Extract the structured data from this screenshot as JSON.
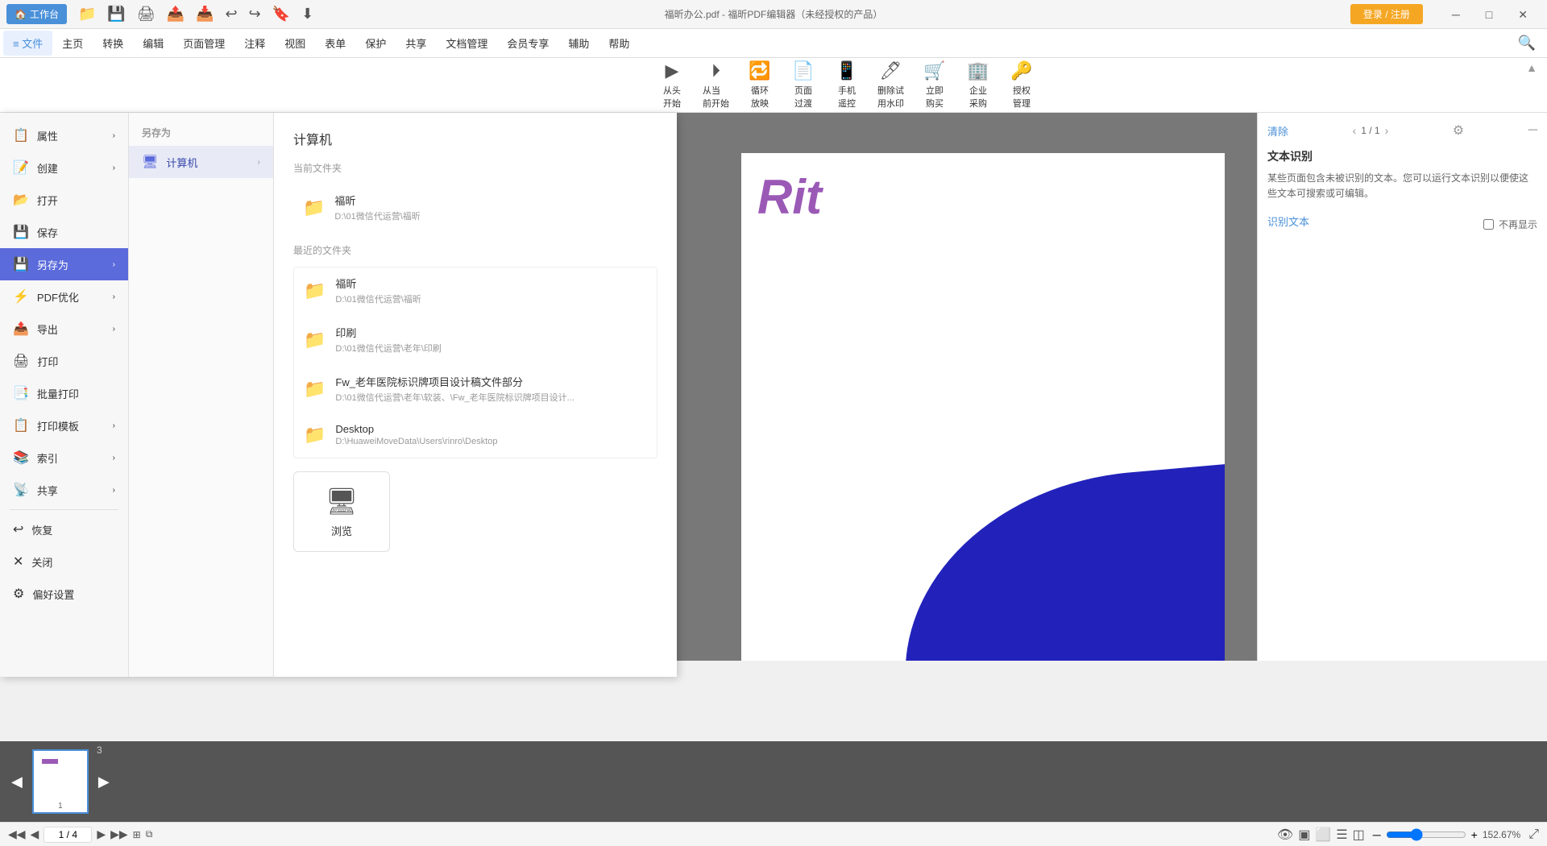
{
  "titlebar": {
    "workbench_label": "工作台",
    "title": "福昕办公.pdf - 福昕PDF编辑器（未经授权的产品）",
    "login_label": "登录 / 注册",
    "toolbar_icons": [
      "folder-open",
      "save",
      "print",
      "export",
      "undo",
      "redo",
      "stamp",
      "download"
    ]
  },
  "menubar": {
    "items": [
      {
        "label": "≡ 文件",
        "key": "file",
        "active": true
      },
      {
        "label": "主页",
        "key": "home"
      },
      {
        "label": "转换",
        "key": "convert"
      },
      {
        "label": "编辑",
        "key": "edit"
      },
      {
        "label": "页面管理",
        "key": "page"
      },
      {
        "label": "注释",
        "key": "annotate"
      },
      {
        "label": "视图",
        "key": "view"
      },
      {
        "label": "表单",
        "key": "form"
      },
      {
        "label": "保护",
        "key": "protect"
      },
      {
        "label": "共享",
        "key": "share"
      },
      {
        "label": "文档管理",
        "key": "doc"
      },
      {
        "label": "会员专享",
        "key": "vip"
      },
      {
        "label": "辅助",
        "key": "assist"
      },
      {
        "label": "帮助",
        "key": "help"
      }
    ]
  },
  "toolbar": {
    "buttons": [
      {
        "label": "从头\n开始",
        "icon": "▶"
      },
      {
        "label": "从当\n前开始",
        "icon": "▶"
      },
      {
        "label": "循环\n放映",
        "icon": "🔄"
      },
      {
        "label": "页面\n过度",
        "icon": "📄"
      },
      {
        "label": "手机\n遥控",
        "icon": "📱"
      },
      {
        "label": "删除试\n用水印",
        "icon": "🖊"
      },
      {
        "label": "立即\n购买",
        "icon": "🛒"
      },
      {
        "label": "企业\n采购",
        "icon": "🏢"
      },
      {
        "label": "授权\n管理",
        "icon": "🔑"
      }
    ]
  },
  "file_menu": {
    "title": "另存为",
    "sidebar_items": [
      {
        "label": "属性",
        "icon": "📋",
        "has_arrow": true
      },
      {
        "label": "创建",
        "icon": "📝",
        "has_arrow": true
      },
      {
        "label": "打开",
        "icon": "📂",
        "has_arrow": false
      },
      {
        "label": "保存",
        "icon": "💾",
        "has_arrow": false
      },
      {
        "label": "另存为",
        "icon": "💾",
        "has_arrow": true,
        "active": true
      },
      {
        "label": "PDF优化",
        "icon": "⚡",
        "has_arrow": true
      },
      {
        "label": "导出",
        "icon": "📤",
        "has_arrow": true
      },
      {
        "label": "打印",
        "icon": "🖨",
        "has_arrow": false
      },
      {
        "label": "批量打印",
        "icon": "📑",
        "has_arrow": false
      },
      {
        "label": "打印模板",
        "icon": "📋",
        "has_arrow": true
      },
      {
        "label": "索引",
        "icon": "📚",
        "has_arrow": true
      },
      {
        "label": "共享",
        "icon": "📡",
        "has_arrow": true
      },
      {
        "label": "恢复",
        "icon": "↩",
        "has_arrow": false
      },
      {
        "label": "关闭",
        "icon": "✕",
        "has_arrow": false
      },
      {
        "label": "偏好设置",
        "icon": "⚙",
        "has_arrow": false
      }
    ],
    "submenu": {
      "title": "另存为",
      "items": [
        {
          "label": "计算机",
          "icon": "🖥",
          "active": true,
          "has_arrow": true
        }
      ]
    },
    "content": {
      "title": "计算机",
      "current_folder_label": "当前文件夹",
      "current_folder": {
        "name": "福昕",
        "path": "D:\\01微信代运营\\福昕"
      },
      "recent_label": "最近的文件夹",
      "recent_folders": [
        {
          "name": "福昕",
          "path": "D:\\01微信代运营\\福昕"
        },
        {
          "name": "印刷",
          "path": "D:\\01微信代运营\\老年\\印刷"
        },
        {
          "name": "Fw_老年医院标识牌项目设计稿文件部分",
          "path": "D:\\01微信代运营\\老年\\软装、\\Fw_老年医院标识牌项目设计..."
        },
        {
          "name": "Desktop",
          "path": "D:\\HuaweiMoveData\\Users\\rinro\\Desktop"
        }
      ],
      "browse_label": "浏览"
    }
  },
  "right_panel": {
    "clear_label": "清除",
    "page_info": "1 / 1",
    "section_title": "文本识别",
    "description": "某些页面包含未被识别的文本。您可以运行文本识别以便使这些文本可搜索或可编辑。",
    "identify_label": "识别文本",
    "no_show_label": "不再显示"
  },
  "status_bar": {
    "page_current": "1",
    "page_total": "4",
    "zoom_percent": "152.67%",
    "nav_icons": [
      "◀◀",
      "◀",
      "▶",
      "▶▶"
    ]
  },
  "pdf_text": "Rit"
}
